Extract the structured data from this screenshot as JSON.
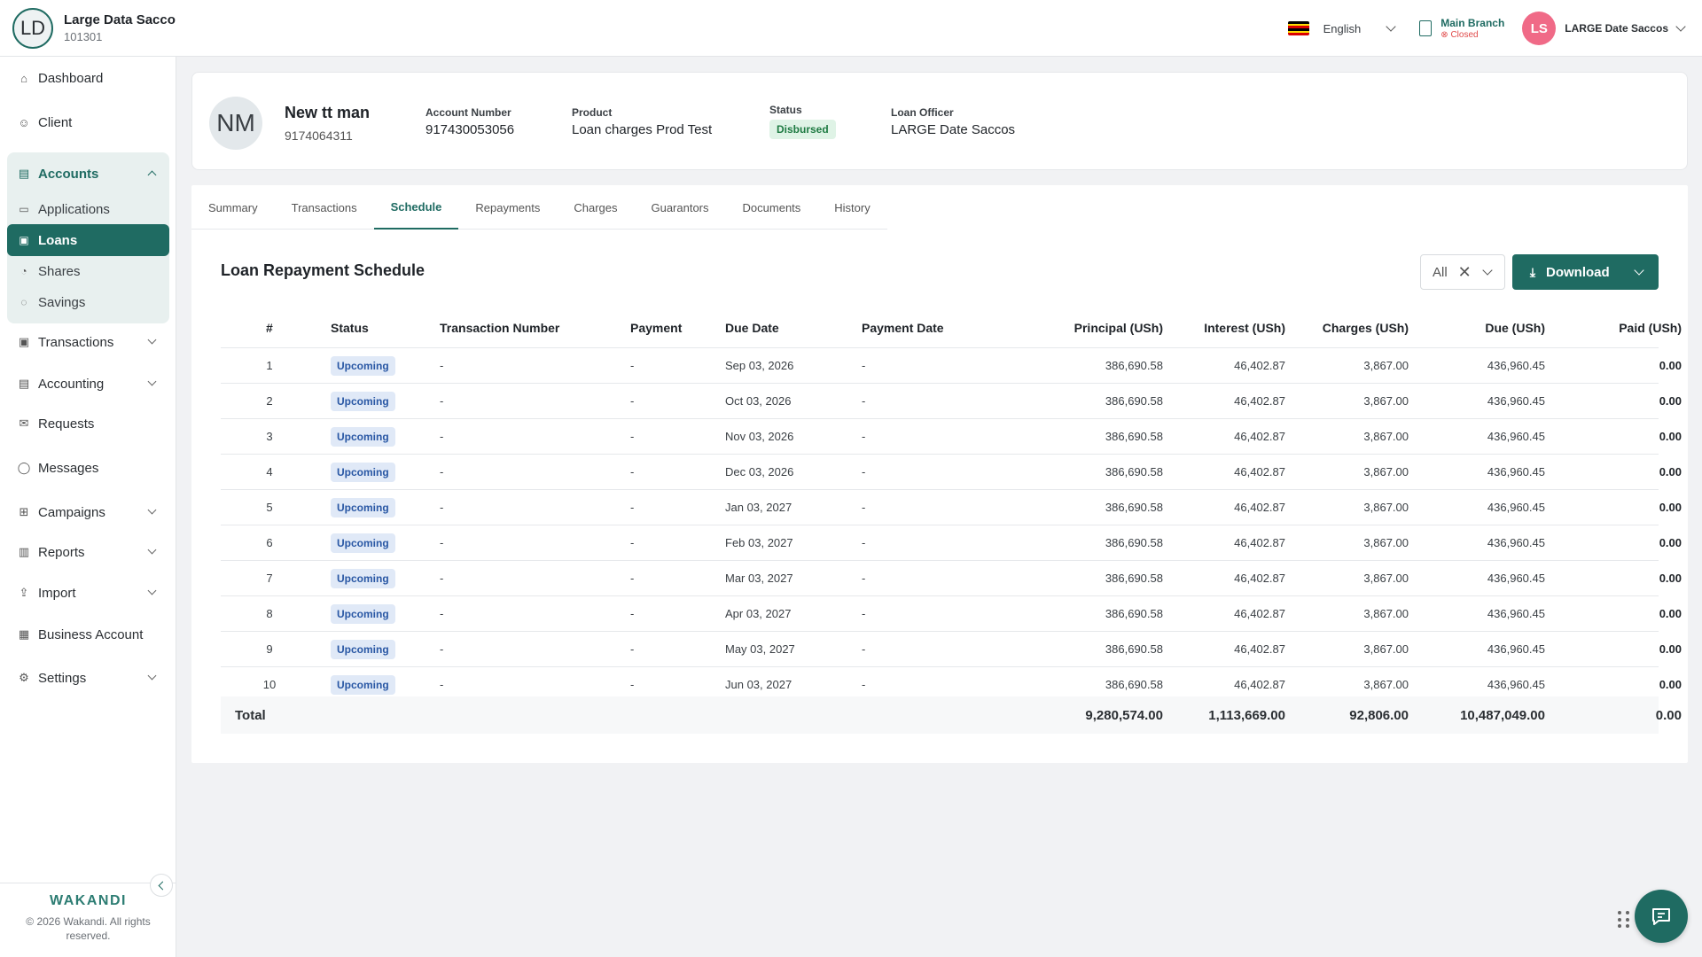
{
  "org": {
    "initials": "LD",
    "name": "Large Data Sacco",
    "code": "101301"
  },
  "topbar": {
    "language": "English",
    "branch_name": "Main Branch",
    "branch_status": "Closed",
    "user_initials": "LS",
    "user_name": "LARGE Date Saccos",
    "colors": {
      "accent": "#1f6b62",
      "avatar": "#f06a87",
      "closed": "#e04a4a"
    }
  },
  "sidebar": {
    "items": [
      {
        "label": "Dashboard",
        "icon": "home-icon"
      },
      {
        "label": "Client",
        "icon": "user-icon"
      },
      {
        "label": "Accounts",
        "icon": "wallet-icon"
      },
      {
        "label": "Applications",
        "icon": "document-icon"
      },
      {
        "label": "Loans",
        "icon": "loan-icon"
      },
      {
        "label": "Shares",
        "icon": "pie-icon"
      },
      {
        "label": "Savings",
        "icon": "savings-icon"
      },
      {
        "label": "Transactions",
        "icon": "transactions-icon"
      },
      {
        "label": "Accounting",
        "icon": "ledger-icon"
      },
      {
        "label": "Requests",
        "icon": "mail-icon"
      },
      {
        "label": "Messages",
        "icon": "chat-icon"
      },
      {
        "label": "Campaigns",
        "icon": "grid-icon"
      },
      {
        "label": "Reports",
        "icon": "chart-icon"
      },
      {
        "label": "Import",
        "icon": "upload-icon"
      },
      {
        "label": "Business Account",
        "icon": "briefcase-icon"
      },
      {
        "label": "Settings",
        "icon": "gear-icon"
      }
    ],
    "brand": "WAKANDI",
    "copyright": "© 2026 Wakandi. All rights reserved."
  },
  "profile": {
    "initials": "NM",
    "name": "New tt man",
    "phone": "9174064311",
    "account_number_label": "Account Number",
    "account_number": "917430053056",
    "product_label": "Product",
    "product": "Loan charges Prod Test",
    "status_label": "Status",
    "status": "Disbursed",
    "officer_label": "Loan Officer",
    "officer": "LARGE Date Saccos"
  },
  "tabs": [
    "Summary",
    "Transactions",
    "Schedule",
    "Repayments",
    "Charges",
    "Guarantors",
    "Documents",
    "History"
  ],
  "schedule": {
    "title": "Loan Repayment Schedule",
    "filter": "All",
    "download_label": "Download",
    "headers": [
      "#",
      "Status",
      "Transaction Number",
      "Payment",
      "Due Date",
      "Payment Date",
      "Principal (USh)",
      "Interest (USh)",
      "Charges (USh)",
      "Due (USh)",
      "Paid (USh)"
    ],
    "rows": [
      [
        "1",
        "Upcoming",
        "-",
        "-",
        "Sep 03, 2026",
        "-",
        "386,690.58",
        "46,402.87",
        "3,867.00",
        "436,960.45",
        "0.00"
      ],
      [
        "2",
        "Upcoming",
        "-",
        "-",
        "Oct 03, 2026",
        "-",
        "386,690.58",
        "46,402.87",
        "3,867.00",
        "436,960.45",
        "0.00"
      ],
      [
        "3",
        "Upcoming",
        "-",
        "-",
        "Nov 03, 2026",
        "-",
        "386,690.58",
        "46,402.87",
        "3,867.00",
        "436,960.45",
        "0.00"
      ],
      [
        "4",
        "Upcoming",
        "-",
        "-",
        "Dec 03, 2026",
        "-",
        "386,690.58",
        "46,402.87",
        "3,867.00",
        "436,960.45",
        "0.00"
      ],
      [
        "5",
        "Upcoming",
        "-",
        "-",
        "Jan 03, 2027",
        "-",
        "386,690.58",
        "46,402.87",
        "3,867.00",
        "436,960.45",
        "0.00"
      ],
      [
        "6",
        "Upcoming",
        "-",
        "-",
        "Feb 03, 2027",
        "-",
        "386,690.58",
        "46,402.87",
        "3,867.00",
        "436,960.45",
        "0.00"
      ],
      [
        "7",
        "Upcoming",
        "-",
        "-",
        "Mar 03, 2027",
        "-",
        "386,690.58",
        "46,402.87",
        "3,867.00",
        "436,960.45",
        "0.00"
      ],
      [
        "8",
        "Upcoming",
        "-",
        "-",
        "Apr 03, 2027",
        "-",
        "386,690.58",
        "46,402.87",
        "3,867.00",
        "436,960.45",
        "0.00"
      ],
      [
        "9",
        "Upcoming",
        "-",
        "-",
        "May 03, 2027",
        "-",
        "386,690.58",
        "46,402.87",
        "3,867.00",
        "436,960.45",
        "0.00"
      ],
      [
        "10",
        "Upcoming",
        "-",
        "-",
        "Jun 03, 2027",
        "-",
        "386,690.58",
        "46,402.87",
        "3,867.00",
        "436,960.45",
        "0.00"
      ]
    ],
    "total": {
      "label": "Total",
      "principal": "9,280,574.00",
      "interest": "1,113,669.00",
      "charges": "92,806.00",
      "due": "10,487,049.00",
      "paid": "0.00"
    }
  }
}
